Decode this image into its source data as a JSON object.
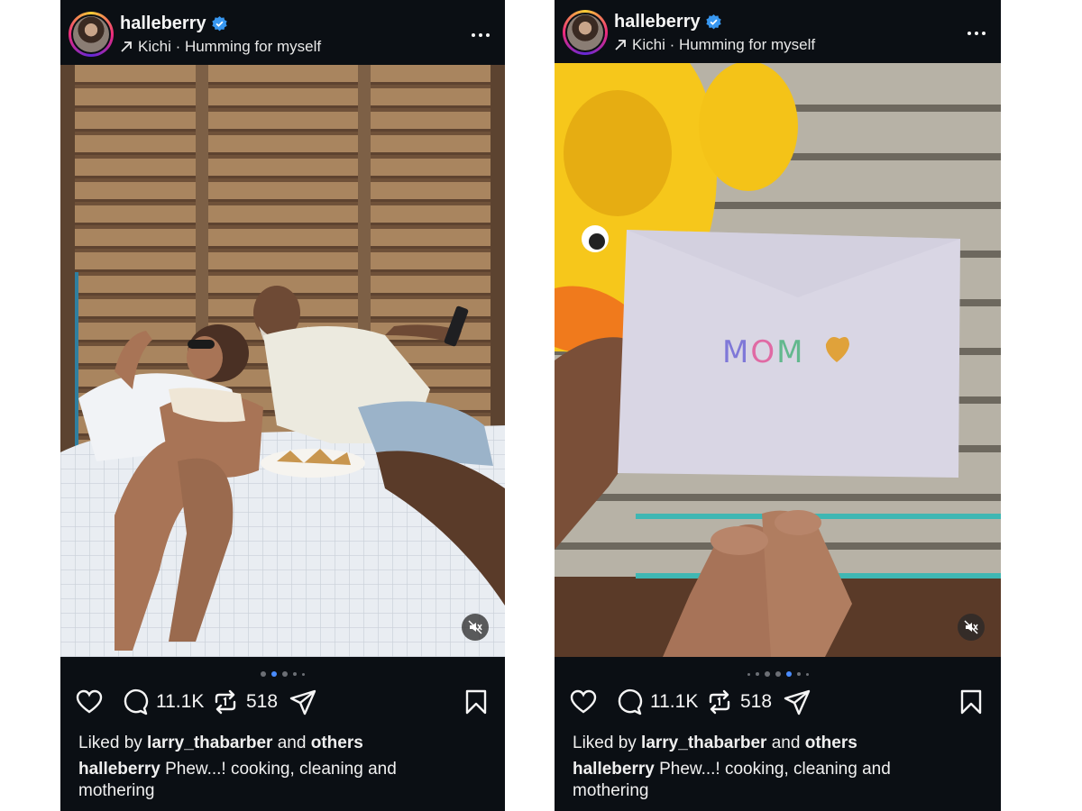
{
  "posts": [
    {
      "username": "halleberry",
      "audio": "Kichi · Humming for myself",
      "comments": "11.1K",
      "reposts": "518",
      "liked_prefix": "Liked by ",
      "liked_user": "larry_thabarber",
      "liked_mid": " and ",
      "liked_others": "others",
      "caption_user": "halleberry",
      "caption_text": " Phew...! cooking, cleaning and mothering"
    },
    {
      "username": "halleberry",
      "audio": "Kichi · Humming for myself",
      "envelope_text": "MOM",
      "comments": "11.1K",
      "reposts": "518",
      "liked_prefix": "Liked by ",
      "liked_user": "larry_thabarber",
      "liked_mid": " and ",
      "liked_others": "others",
      "caption_user": "halleberry",
      "caption_text": " Phew...! cooking, cleaning and mothering"
    }
  ],
  "colors": {
    "background": "#0b0f14",
    "verified": "#3897f0",
    "active_dot": "#4a8cff"
  },
  "icons": [
    "verified-badge-icon",
    "audio-arrow-icon",
    "more-icon",
    "mute-icon",
    "heart-icon",
    "comment-icon",
    "repost-icon",
    "share-icon",
    "bookmark-icon"
  ]
}
